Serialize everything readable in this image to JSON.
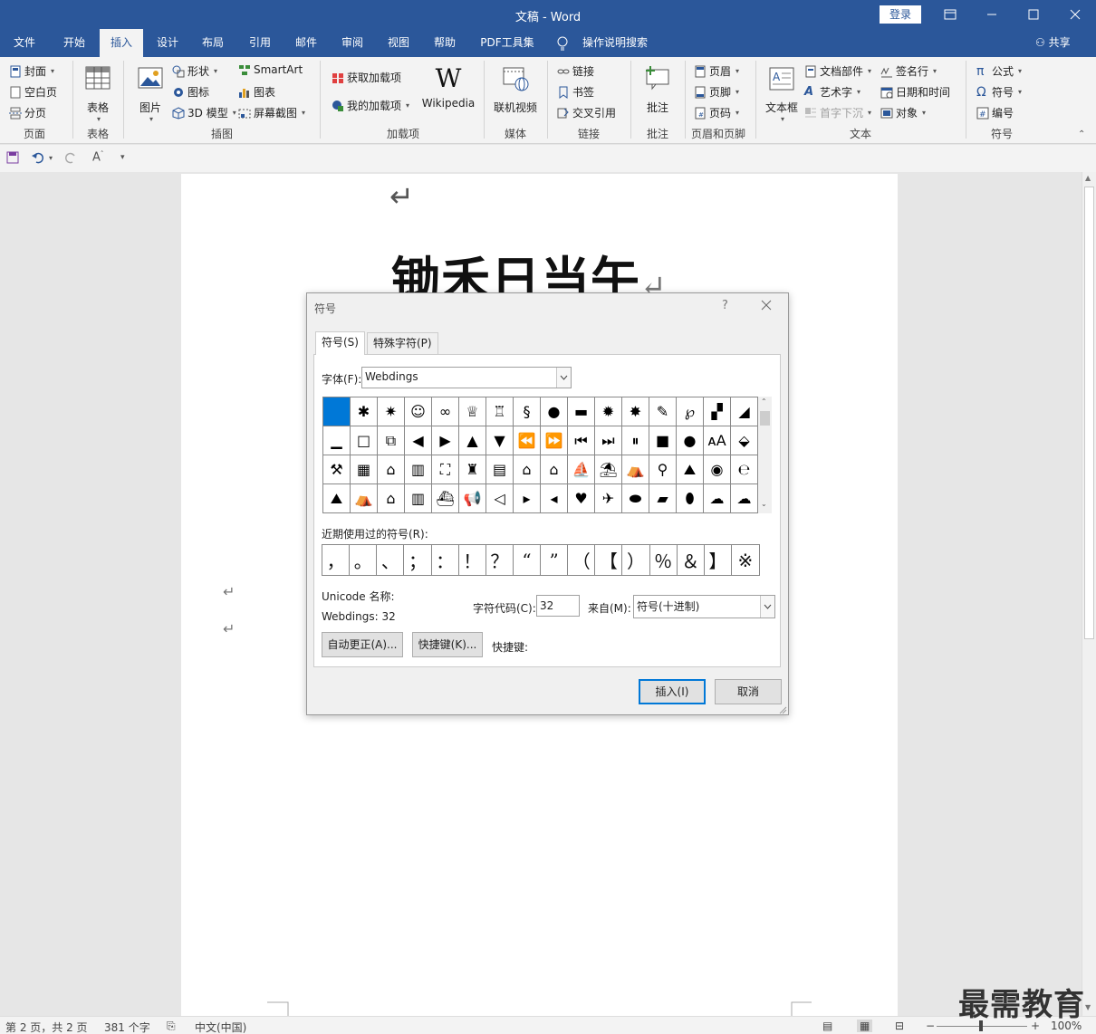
{
  "window": {
    "title": "文稿  -  Word",
    "login_label": "登录"
  },
  "menu_tabs": [
    "文件",
    "开始",
    "插入",
    "设计",
    "布局",
    "引用",
    "邮件",
    "审阅",
    "视图",
    "帮助",
    "PDF工具集"
  ],
  "active_tab": "插入",
  "tell_me": "操作说明搜索",
  "share_label": "共享",
  "ribbon": {
    "page": {
      "cover": "封面",
      "blank": "空白页",
      "break": "分页",
      "label": "页面"
    },
    "table": {
      "table": "表格",
      "label": "表格"
    },
    "illustrations": {
      "picture": "图片",
      "shapes": "形状",
      "icons": "图标",
      "model3d": "3D 模型",
      "smartart": "SmartArt",
      "chart": "图表",
      "screenshot": "屏幕截图",
      "label": "插图"
    },
    "addins": {
      "get": "获取加载项",
      "mine": "我的加载项",
      "wikipedia": "Wikipedia",
      "label": "加载项"
    },
    "media": {
      "video": "联机视频",
      "label": "媒体"
    },
    "links": {
      "link": "链接",
      "bookmark": "书签",
      "crossref": "交叉引用",
      "label": "链接"
    },
    "comments": {
      "comment": "批注",
      "label": "批注"
    },
    "headerfooter": {
      "header": "页眉",
      "footer": "页脚",
      "pagenum": "页码",
      "label": "页眉和页脚"
    },
    "text": {
      "textbox": "文本框",
      "parts": "文档部件",
      "wordart": "艺术字",
      "dropcap": "首字下沉",
      "signature": "签名行",
      "datetime": "日期和时间",
      "object": "对象",
      "label": "文本"
    },
    "symbols": {
      "equation": "公式",
      "symbol": "符号",
      "number": "编号",
      "label": "符号"
    }
  },
  "document": {
    "title": "锄禾日当午",
    "para_mark": "↵"
  },
  "dialog": {
    "title": "符号",
    "help": "?",
    "tab_symbols": "符号(S)",
    "tab_special": "特殊字符(P)",
    "font_label": "字体(F):",
    "font_value": "Webdings",
    "recent_label": "近期使用过的符号(R):",
    "recent_symbols": [
      "，",
      "。",
      "、",
      "；",
      "：",
      "！",
      "？",
      "“",
      "”",
      "（",
      "【",
      "）",
      "％",
      "＆",
      "】",
      "※"
    ],
    "unicode_label": "Unicode 名称:",
    "unicode_value": "Webdings: 32",
    "charcode_label": "字符代码(C):",
    "charcode_value": "32",
    "from_label": "来自(M):",
    "from_value": "符号(十进制)",
    "autocorrect_btn": "自动更正(A)...",
    "shortcut_btn": "快捷键(K)...",
    "shortcut_label": "快捷键:",
    "insert_btn": "插入(I)",
    "cancel_btn": "取消"
  },
  "status": {
    "pages": "第 2 页，共 2 页",
    "words": "381 个字",
    "language": "中文(中国)",
    "zoom": "100%"
  },
  "watermark": "最需教育"
}
